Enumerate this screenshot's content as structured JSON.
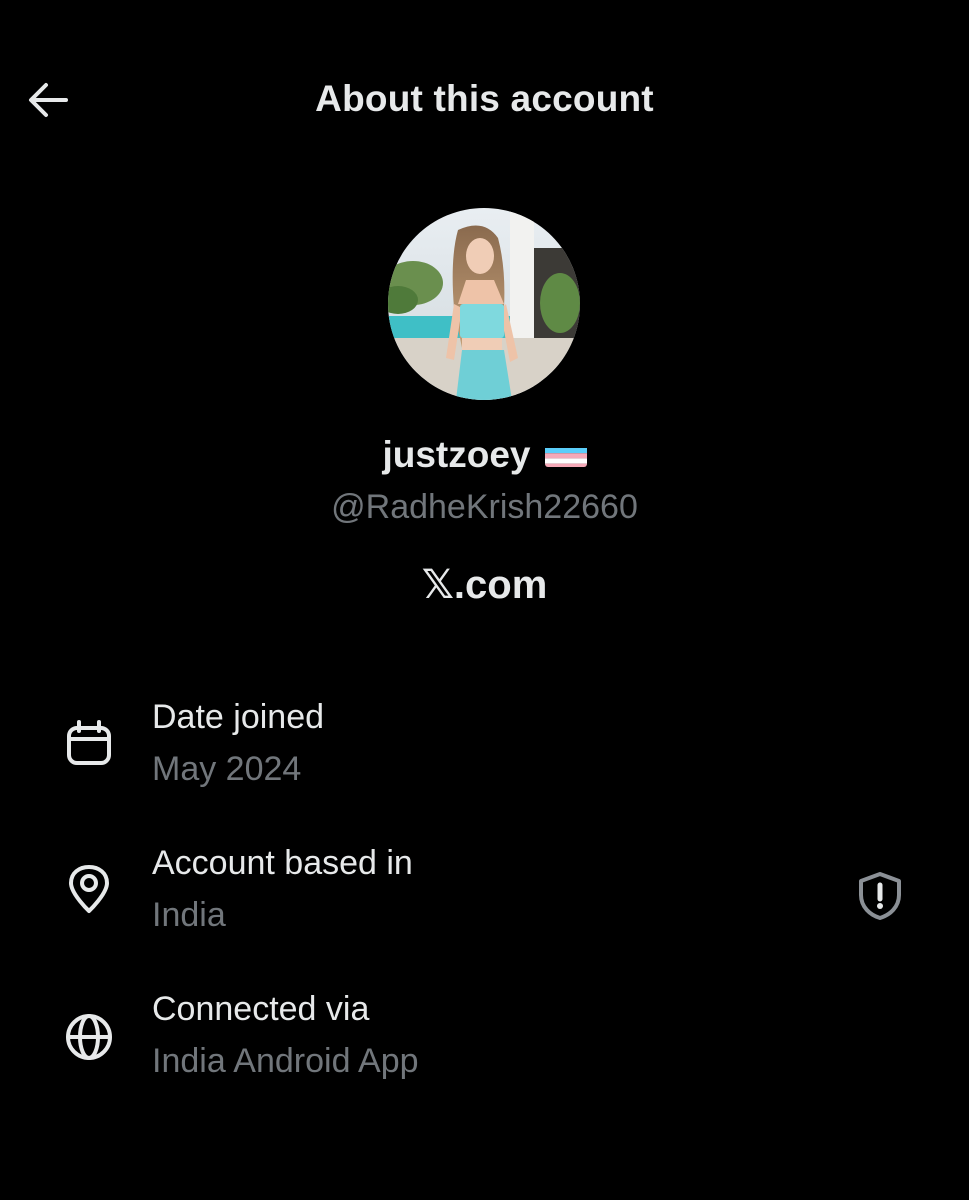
{
  "header": {
    "back_icon": "arrow-left-icon",
    "title": "About this account"
  },
  "profile": {
    "display_name": "justzoey",
    "flag_icon": "transgender-flag-emoji",
    "handle": "@RadheKrish22660",
    "site": "𝕏.com"
  },
  "details": {
    "date_joined": {
      "icon": "calendar-icon",
      "label": "Date joined",
      "value": "May 2024"
    },
    "account_based_in": {
      "icon": "location-pin-icon",
      "label": "Account based in",
      "value": "India",
      "action_icon": "shield-alert-icon"
    },
    "connected_via": {
      "icon": "globe-icon",
      "label": "Connected via",
      "value": "India Android App"
    }
  },
  "colors": {
    "background": "#000000",
    "primary_text": "#e7e9ea",
    "secondary_text": "#71767b"
  }
}
